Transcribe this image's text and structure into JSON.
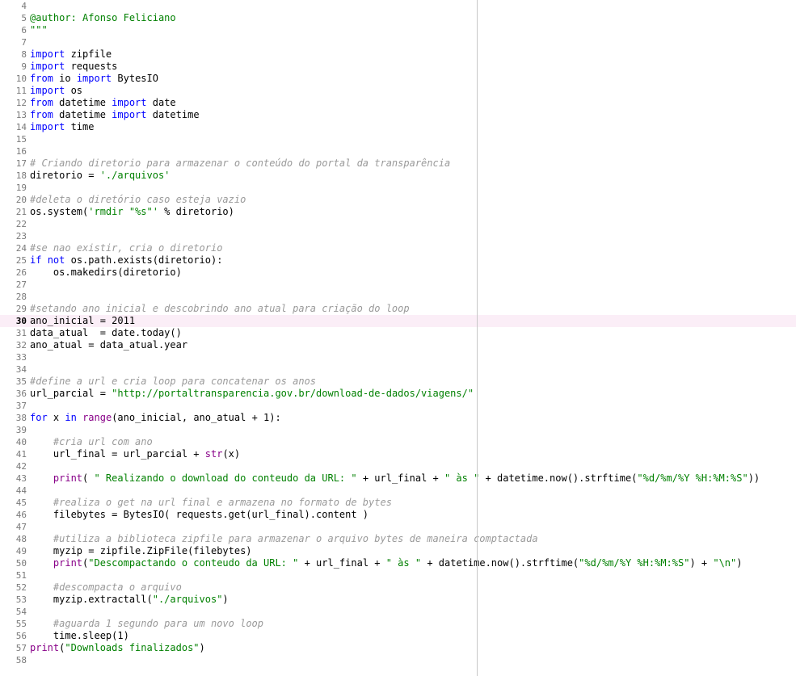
{
  "editor": {
    "current_line": 30,
    "lines": [
      {
        "n": "4",
        "t": []
      },
      {
        "n": "5",
        "t": [
          [
            "@author: Afonso Feliciano",
            "string"
          ]
        ]
      },
      {
        "n": "6",
        "t": [
          [
            "\"\"\"",
            "string"
          ]
        ]
      },
      {
        "n": "7",
        "t": []
      },
      {
        "n": "8",
        "t": [
          [
            "import",
            "keyword"
          ],
          [
            " zipfile",
            "default"
          ]
        ]
      },
      {
        "n": "9",
        "t": [
          [
            "import",
            "keyword"
          ],
          [
            " requests",
            "default"
          ]
        ]
      },
      {
        "n": "10",
        "t": [
          [
            "from",
            "keyword"
          ],
          [
            " io ",
            "default"
          ],
          [
            "import",
            "keyword"
          ],
          [
            " BytesIO",
            "default"
          ]
        ]
      },
      {
        "n": "11",
        "t": [
          [
            "import",
            "keyword"
          ],
          [
            " os",
            "default"
          ]
        ]
      },
      {
        "n": "12",
        "t": [
          [
            "from",
            "keyword"
          ],
          [
            " datetime ",
            "default"
          ],
          [
            "import",
            "keyword"
          ],
          [
            " date",
            "default"
          ]
        ]
      },
      {
        "n": "13",
        "t": [
          [
            "from",
            "keyword"
          ],
          [
            " datetime ",
            "default"
          ],
          [
            "import",
            "keyword"
          ],
          [
            " datetime",
            "default"
          ]
        ]
      },
      {
        "n": "14",
        "t": [
          [
            "import",
            "keyword"
          ],
          [
            " time",
            "default"
          ]
        ]
      },
      {
        "n": "15",
        "t": []
      },
      {
        "n": "16",
        "t": []
      },
      {
        "n": "17",
        "t": [
          [
            "# Criando diretorio para armazenar o conteúdo do portal da transparência",
            "comment"
          ]
        ]
      },
      {
        "n": "18",
        "t": [
          [
            "diretorio = ",
            "default"
          ],
          [
            "'./arquivos'",
            "string"
          ]
        ]
      },
      {
        "n": "19",
        "t": []
      },
      {
        "n": "20",
        "t": [
          [
            "#deleta o diretório caso esteja vazio",
            "comment"
          ]
        ]
      },
      {
        "n": "21",
        "t": [
          [
            "os.system(",
            "default"
          ],
          [
            "'rmdir \"%s\"'",
            "string"
          ],
          [
            " % diretorio)",
            "default"
          ]
        ]
      },
      {
        "n": "22",
        "t": []
      },
      {
        "n": "23",
        "t": []
      },
      {
        "n": "24",
        "t": [
          [
            "#se nao existir, cria o diretorio",
            "comment"
          ]
        ]
      },
      {
        "n": "25",
        "t": [
          [
            "if",
            "keyword"
          ],
          [
            " ",
            "default"
          ],
          [
            "not",
            "keyword"
          ],
          [
            " os.path.exists(diretorio):",
            "default"
          ]
        ]
      },
      {
        "n": "26",
        "t": [
          [
            "    os.makedirs(diretorio)",
            "default"
          ]
        ]
      },
      {
        "n": "27",
        "t": []
      },
      {
        "n": "28",
        "t": []
      },
      {
        "n": "29",
        "t": [
          [
            "#setando ano inicial e descobrindo ano atual para criação do loop",
            "comment"
          ]
        ]
      },
      {
        "n": "30",
        "t": [
          [
            "ano_inicial = ",
            "default"
          ],
          [
            "2011",
            "number"
          ]
        ]
      },
      {
        "n": "31",
        "t": [
          [
            "data_atual  = date.today()",
            "default"
          ]
        ]
      },
      {
        "n": "32",
        "t": [
          [
            "ano_atual = data_atual.year",
            "default"
          ]
        ]
      },
      {
        "n": "33",
        "t": []
      },
      {
        "n": "34",
        "t": []
      },
      {
        "n": "35",
        "t": [
          [
            "#define a url e cria loop para concatenar os anos",
            "comment"
          ]
        ]
      },
      {
        "n": "36",
        "t": [
          [
            "url_parcial = ",
            "default"
          ],
          [
            "\"http://portaltransparencia.gov.br/download-de-dados/viagens/\"",
            "string"
          ]
        ]
      },
      {
        "n": "37",
        "t": []
      },
      {
        "n": "38",
        "t": [
          [
            "for",
            "keyword"
          ],
          [
            " x ",
            "default"
          ],
          [
            "in",
            "keyword"
          ],
          [
            " ",
            "default"
          ],
          [
            "range",
            "builtin"
          ],
          [
            "(ano_inicial, ano_atual + 1):",
            "default"
          ]
        ]
      },
      {
        "n": "39",
        "t": []
      },
      {
        "n": "40",
        "t": [
          [
            "    ",
            "default"
          ],
          [
            "#cria url com ano",
            "comment"
          ]
        ]
      },
      {
        "n": "41",
        "t": [
          [
            "    url_final = url_parcial + ",
            "default"
          ],
          [
            "str",
            "builtin"
          ],
          [
            "(x)",
            "default"
          ]
        ]
      },
      {
        "n": "42",
        "t": []
      },
      {
        "n": "43",
        "t": [
          [
            "    ",
            "default"
          ],
          [
            "print",
            "builtin"
          ],
          [
            "( ",
            "default"
          ],
          [
            "\" Realizando o download do conteudo da URL: \"",
            "string"
          ],
          [
            " + url_final + ",
            "default"
          ],
          [
            "\" às \"",
            "string"
          ],
          [
            " + datetime.now().strftime(",
            "default"
          ],
          [
            "\"%d/%m/%Y %H:%M:%S\"",
            "string"
          ],
          [
            "))",
            "default"
          ]
        ]
      },
      {
        "n": "44",
        "t": []
      },
      {
        "n": "45",
        "t": [
          [
            "    ",
            "default"
          ],
          [
            "#realiza o get na url final e armazena no formato de bytes",
            "comment"
          ]
        ]
      },
      {
        "n": "46",
        "t": [
          [
            "    filebytes = BytesIO( requests.get(url_final).content )",
            "default"
          ]
        ]
      },
      {
        "n": "47",
        "t": []
      },
      {
        "n": "48",
        "t": [
          [
            "    ",
            "default"
          ],
          [
            "#utiliza a biblioteca zipfile para armazenar o arquivo bytes de maneira comptactada",
            "comment"
          ]
        ]
      },
      {
        "n": "49",
        "t": [
          [
            "    myzip = zipfile.ZipFile(filebytes)",
            "default"
          ]
        ]
      },
      {
        "n": "50",
        "t": [
          [
            "    ",
            "default"
          ],
          [
            "print",
            "builtin"
          ],
          [
            "(",
            "default"
          ],
          [
            "\"Descompactando o conteudo da URL: \"",
            "string"
          ],
          [
            " + url_final + ",
            "default"
          ],
          [
            "\" às \"",
            "string"
          ],
          [
            " + datetime.now().strftime(",
            "default"
          ],
          [
            "\"%d/%m/%Y %H:%M:%S\"",
            "string"
          ],
          [
            ") + ",
            "default"
          ],
          [
            "\"\\n\"",
            "string"
          ],
          [
            ")",
            "default"
          ]
        ]
      },
      {
        "n": "51",
        "t": []
      },
      {
        "n": "52",
        "t": [
          [
            "    ",
            "default"
          ],
          [
            "#descompacta o arquivo",
            "comment"
          ]
        ]
      },
      {
        "n": "53",
        "t": [
          [
            "    myzip.extractall(",
            "default"
          ],
          [
            "\"./arquivos\"",
            "string"
          ],
          [
            ")",
            "default"
          ]
        ]
      },
      {
        "n": "54",
        "t": []
      },
      {
        "n": "55",
        "t": [
          [
            "    ",
            "default"
          ],
          [
            "#aguarda 1 segundo para um novo loop",
            "comment"
          ]
        ]
      },
      {
        "n": "56",
        "t": [
          [
            "    time.sleep(1)",
            "default"
          ]
        ]
      },
      {
        "n": "57",
        "t": [
          [
            "print",
            "builtin"
          ],
          [
            "(",
            "default"
          ],
          [
            "\"Downloads finalizados\"",
            "string"
          ],
          [
            ")",
            "default"
          ]
        ]
      },
      {
        "n": "58",
        "t": []
      }
    ]
  }
}
